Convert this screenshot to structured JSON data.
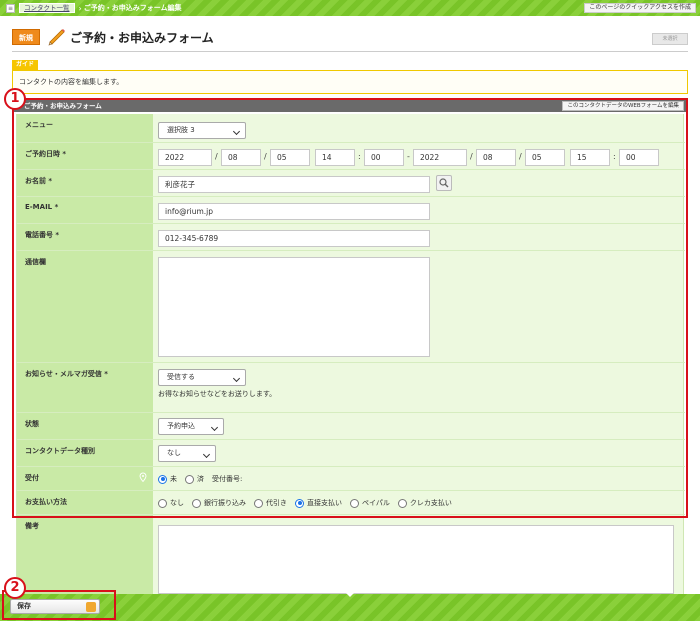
{
  "topbar": {
    "home_glyph": "≡",
    "breadcrumb_link": "コンタクト一覧",
    "breadcrumb_sep": "›",
    "breadcrumb_current": "ご予約・お申込みフォーム編集",
    "quick_access": "このページのクイックアクセスを作成"
  },
  "header": {
    "badge": "新規",
    "title": "ご予約・お申込みフォーム",
    "right_button": "未選択"
  },
  "guide": {
    "label": "ガイド",
    "text": "コンタクトの内容を編集します。"
  },
  "panel": {
    "title": "ご予約・お申込みフォーム",
    "edit_button": "このコンタクトデータのWEBフォームを編集"
  },
  "fields": {
    "menu": {
      "label": "メニュー",
      "value": "選択肢 3"
    },
    "reserve_date": {
      "label": "ご予約日時 *",
      "from": {
        "year": "2022",
        "month": "08",
        "day": "05",
        "hour": "14",
        "minute": "00"
      },
      "to": {
        "year": "2022",
        "month": "08",
        "day": "05",
        "hour": "15",
        "minute": "00"
      },
      "date_sep": "/",
      "time_sep": ":",
      "range_sep": "-"
    },
    "name": {
      "label": "お名前 *",
      "value": "利彦花子"
    },
    "email": {
      "label": "E-MAIL *",
      "value": "info@rium.jp"
    },
    "phone": {
      "label": "電話番号 *",
      "value": "012-345-6789"
    },
    "message": {
      "label": "通信欄",
      "value": ""
    },
    "newsletter": {
      "label": "お知らせ・メルマガ受信 *",
      "value": "受信する",
      "hint": "お得なお知らせなどをお送りします。"
    },
    "status": {
      "label": "状態",
      "value": "予約申込"
    },
    "contact_type": {
      "label": "コンタクトデータ種別",
      "value": "なし"
    },
    "reception": {
      "label": "受付",
      "options": [
        "未",
        "済"
      ],
      "selected": "未",
      "number_label": "受付番号:"
    },
    "payment": {
      "label": "お支払い方法",
      "options": [
        "なし",
        "銀行振り込み",
        "代引き",
        "直接支払い",
        "ペイパル",
        "クレカ支払い"
      ],
      "selected": "直接支払い"
    },
    "remarks": {
      "label": "備考",
      "value": ""
    }
  },
  "annotations": {
    "one": "1",
    "two": "2"
  },
  "footer": {
    "save_label": "保存"
  },
  "colors": {
    "accent_green": "#79c428",
    "label_bg": "#c9eaa6",
    "form_bg": "#edf9df",
    "highlight_red": "#d8101a",
    "badge_orange": "#ef8a1b"
  }
}
